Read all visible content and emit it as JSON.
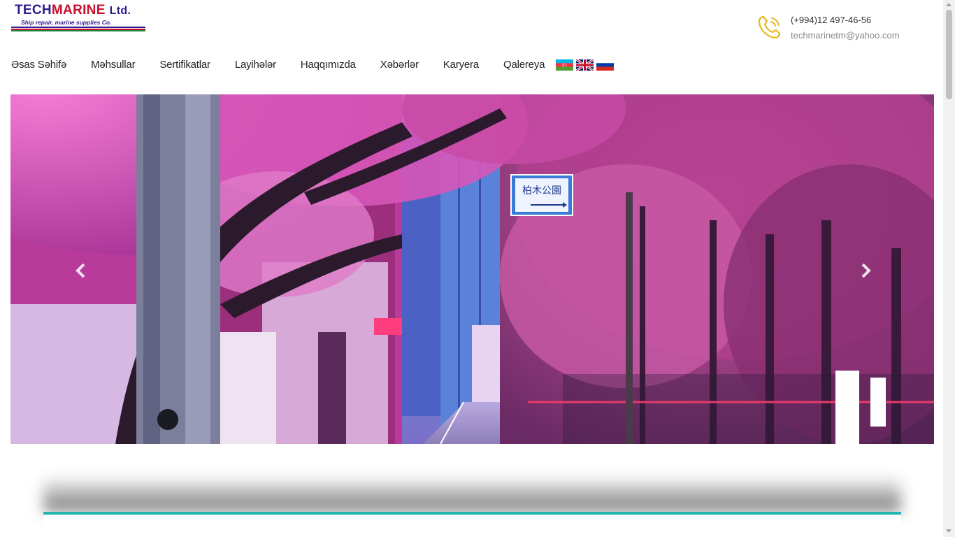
{
  "brand": {
    "name_part1": "TECH",
    "name_part2": "MARINE",
    "name_suffix": "Ltd.",
    "tagline": "Ship repair, marine supplies Co.",
    "colors": {
      "primary": "#2e1d8e",
      "accent": "#c8102e",
      "stripe_green": "#1e8a3e"
    }
  },
  "contact": {
    "icon": "phone-icon",
    "phone": "(+994)12 497-46-56",
    "email": "techmarinetm@yahoo.com",
    "icon_color": "#e8b81f"
  },
  "nav": {
    "items": [
      {
        "label": "Əsas Səhifə"
      },
      {
        "label": "Məhsullar"
      },
      {
        "label": "Sertifikatlar"
      },
      {
        "label": "Layihələr"
      },
      {
        "label": "Haqqımızda"
      },
      {
        "label": "Xəbərlər"
      },
      {
        "label": "Karyera"
      },
      {
        "label": "Qalereya"
      }
    ],
    "languages": [
      {
        "icon": "azerbaijan-flag-icon"
      },
      {
        "icon": "uk-flag-icon"
      },
      {
        "icon": "russia-flag-icon"
      }
    ]
  },
  "hero": {
    "image": "street-with-pink-cherry-blossom-trees-image",
    "sign_text": "柏木公園",
    "prev_icon": "chevron-left-icon",
    "next_icon": "chevron-right-icon"
  },
  "section": {
    "accent_color": "#27b5b2"
  }
}
